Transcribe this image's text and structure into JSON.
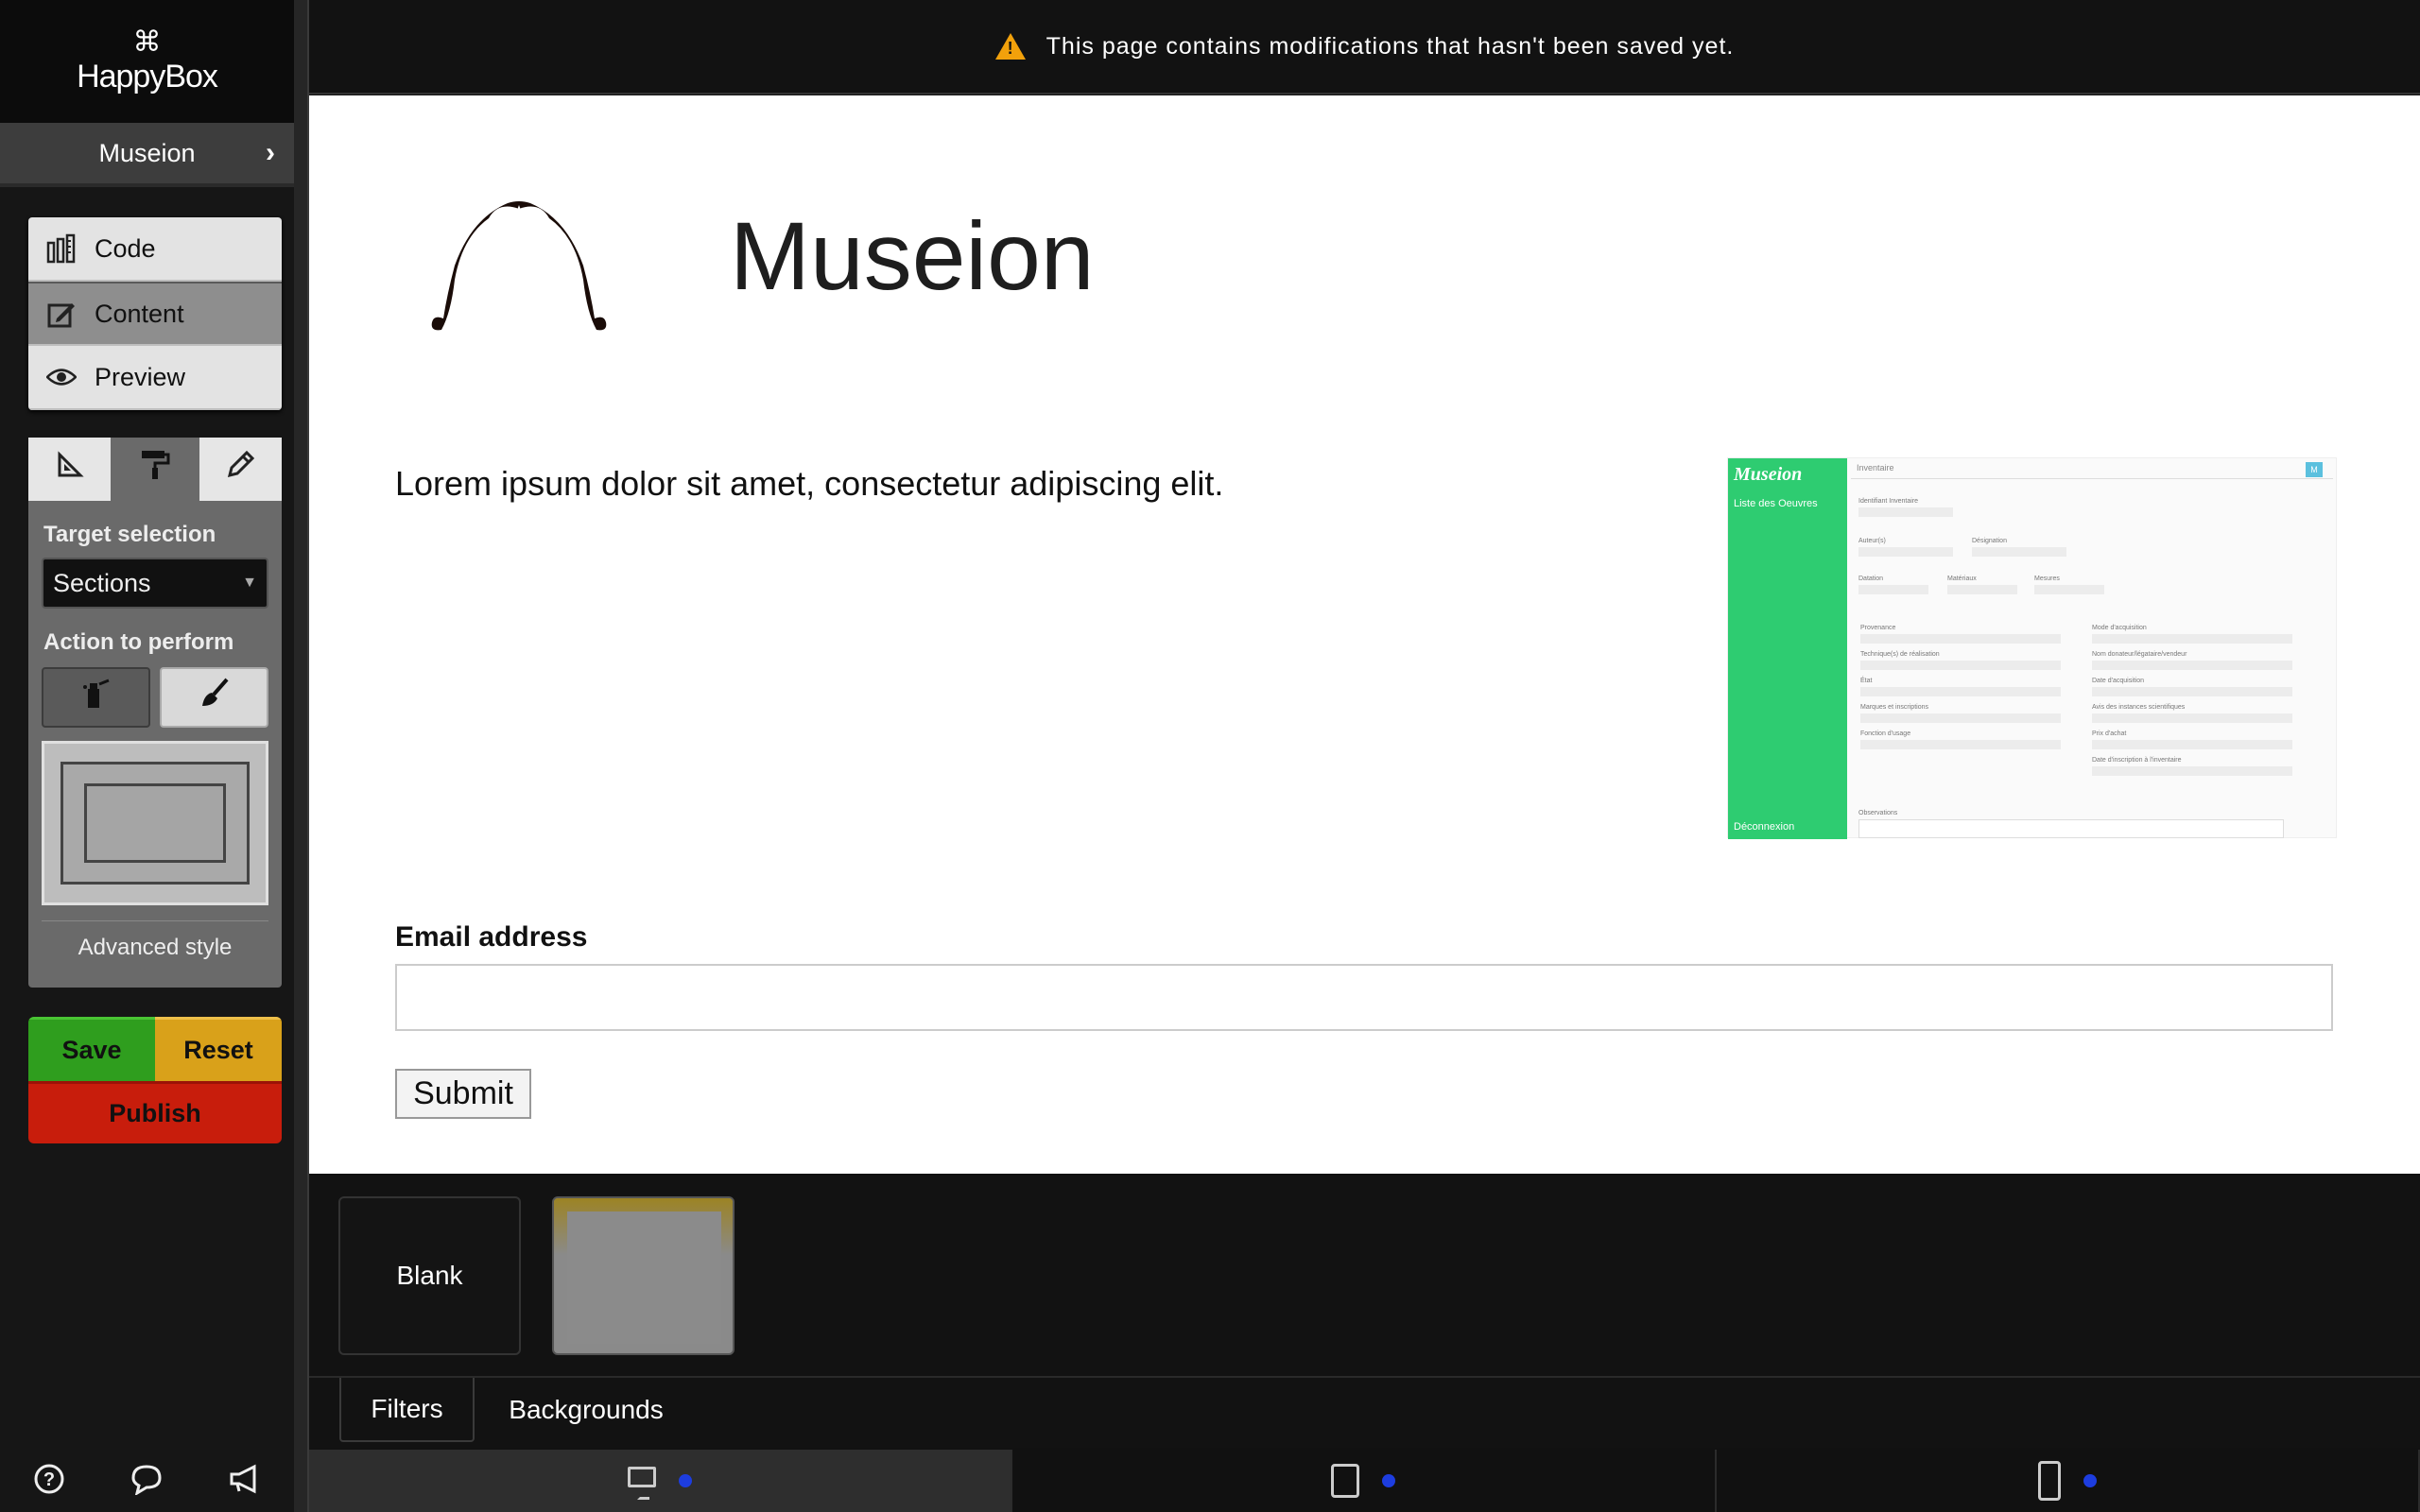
{
  "app": {
    "brand": "HappyBox",
    "project": "Museion"
  },
  "modes": [
    {
      "label": "Code",
      "icon": "code-ruler-icon"
    },
    {
      "label": "Content",
      "icon": "edit-icon"
    },
    {
      "label": "Preview",
      "icon": "eye-icon"
    }
  ],
  "style_panel": {
    "target_label": "Target selection",
    "target_value": "Sections",
    "action_label": "Action to perform",
    "advanced_label": "Advanced style"
  },
  "actions": {
    "save": "Save",
    "reset": "Reset",
    "publish": "Publish"
  },
  "banner": {
    "message": "This page contains modifications that hasn't been saved yet."
  },
  "page": {
    "title": "Museion",
    "lorem": "Lorem ipsum dolor sit amet, consectetur adipiscing elit.",
    "email_label": "Email address",
    "email_value": "",
    "submit": "Submit",
    "thumb": {
      "brand": "Museion",
      "nav_item": "Liste des Oeuvres",
      "logout": "Déconnexion",
      "tab": "Inventaire",
      "badge": "M",
      "fields": [
        "Identifiant Inventaire",
        "Auteur(s)",
        "Désignation",
        "Datation",
        "Matériaux",
        "Mesures",
        "Provenance",
        "Mode d'acquisition",
        "Technique(s) de réalisation",
        "Nom donateur/légataire/vendeur",
        "État",
        "Date d'acquisition",
        "Marques et inscriptions",
        "Avis des instances scientifiques",
        "Fonction d'usage",
        "Prix d'achat",
        "Date d'inscription à l'inventaire",
        "Observations"
      ]
    }
  },
  "tray": {
    "tiles": [
      {
        "label": "Blank"
      }
    ],
    "tabs": [
      "Filters",
      "Backgrounds"
    ]
  },
  "devices": [
    "desktop",
    "tablet",
    "phone"
  ]
}
